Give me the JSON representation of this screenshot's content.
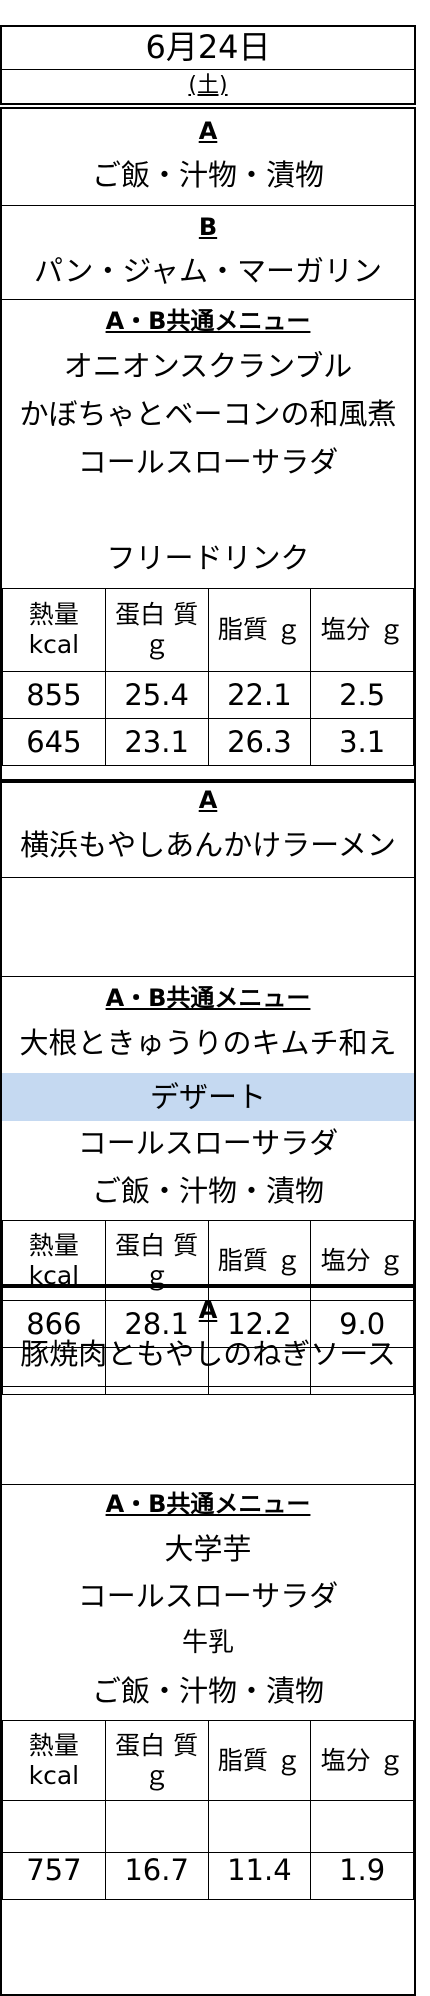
{
  "header": {
    "date": "6月24日",
    "weekday": "(土)"
  },
  "meal1": {
    "a_label": "A",
    "a_item": "ご飯・汁物・漬物",
    "b_label": "B",
    "b_item": "パン・ジャム・マーガリン",
    "common_label": "A・B共通メニュー",
    "common_items": [
      "オニオンスクランブル",
      "かぼちゃとベーコンの和風煮",
      "コールスローサラダ"
    ],
    "drink": "フリードリンク",
    "nutrition_headers": [
      "熱量 kcal",
      "蛋白 質ｇ",
      "脂質 ｇ",
      "塩分 ｇ"
    ],
    "nutrition_rows": [
      [
        "855",
        "25.4",
        "22.1",
        "2.5"
      ],
      [
        "645",
        "23.1",
        "26.3",
        "3.1"
      ]
    ]
  },
  "meal2": {
    "a_label": "A",
    "a_item": "横浜もやしあんかけラーメン",
    "common_label": "A・B共通メニュー",
    "common_item": "大根ときゅうりのキムチ和え",
    "dessert_label": "デザート",
    "items": [
      "コールスローサラダ",
      "ご飯・汁物・漬物"
    ],
    "nutrition_headers": [
      "熱量 kcal",
      "蛋白 質ｇ",
      "脂質 ｇ",
      "塩分 ｇ"
    ],
    "nutrition_rows": [
      [
        "866",
        "28.1",
        "12.2",
        "9.0"
      ]
    ]
  },
  "meal3": {
    "a_label": "A",
    "a_item": "豚焼肉ともやしのねぎソース",
    "common_label": "A・B共通メニュー",
    "common_items": [
      "大学芋",
      "コールスローサラダ",
      "牛乳",
      "ご飯・汁物・漬物"
    ],
    "nutrition_headers": [
      "熱量 kcal",
      "蛋白 質ｇ",
      "脂質 ｇ",
      "塩分 ｇ"
    ],
    "nutrition_rows": [
      [
        "757",
        "16.7",
        "11.4",
        "1.9"
      ]
    ]
  }
}
